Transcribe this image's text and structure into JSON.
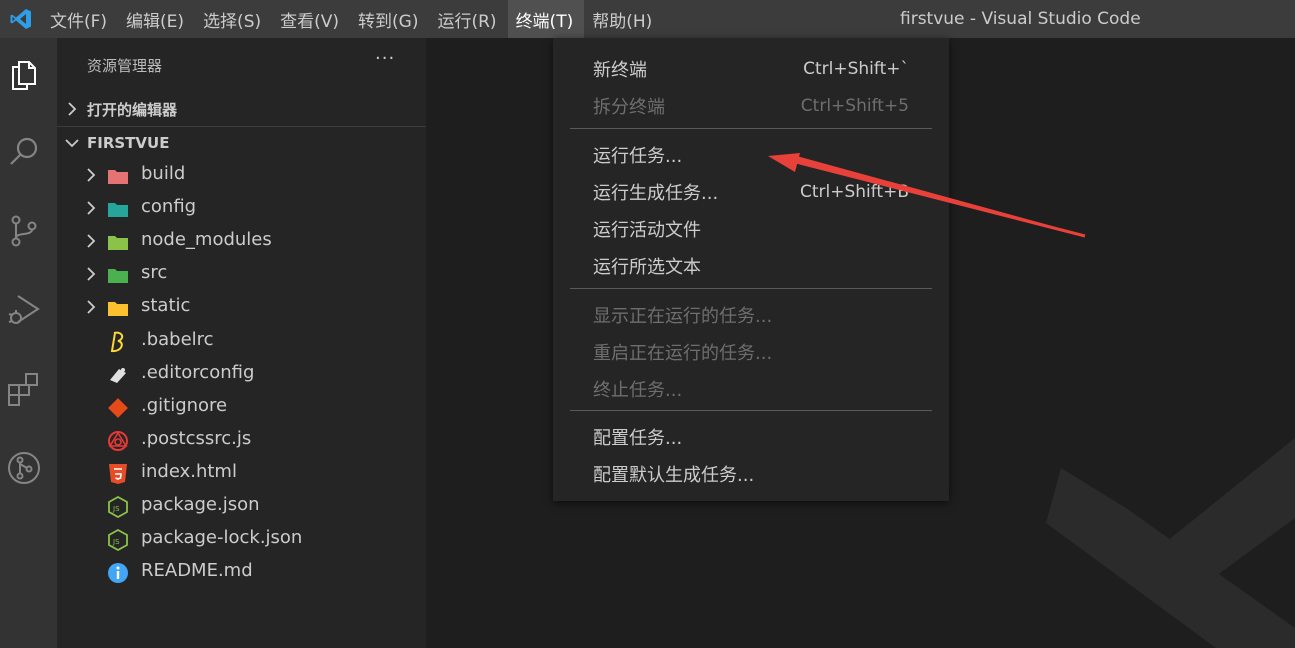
{
  "window": {
    "title": "firstvue - Visual Studio Code"
  },
  "menubar": {
    "items": [
      "文件(F)",
      "编辑(E)",
      "选择(S)",
      "查看(V)",
      "转到(G)",
      "运行(R)",
      "终端(T)",
      "帮助(H)"
    ],
    "active_index": 6
  },
  "activitybar": {
    "icons": [
      "files-icon",
      "search-icon",
      "source-control-icon",
      "run-debug-icon",
      "extensions-icon",
      "git-graph-icon"
    ],
    "active": "files-icon"
  },
  "sidebar": {
    "title": "资源管理器",
    "more": "···",
    "open_editors": {
      "label": "打开的编辑器",
      "expanded": false
    },
    "project": {
      "label": "FIRSTVUE",
      "expanded": true
    },
    "tree": [
      {
        "name": "build",
        "type": "folder",
        "icon": "folder-build-icon",
        "color": "#e57373"
      },
      {
        "name": "config",
        "type": "folder",
        "icon": "folder-config-icon",
        "color": "#26a69a"
      },
      {
        "name": "node_modules",
        "type": "folder",
        "icon": "folder-node-icon",
        "color": "#8bc34a"
      },
      {
        "name": "src",
        "type": "folder",
        "icon": "folder-src-icon",
        "color": "#4caf50"
      },
      {
        "name": "static",
        "type": "folder",
        "icon": "folder-static-icon",
        "color": "#fbc02d"
      },
      {
        "name": ".babelrc",
        "type": "file",
        "icon": "babel-icon",
        "color": "#fdd835"
      },
      {
        "name": ".editorconfig",
        "type": "file",
        "icon": "editorconfig-icon",
        "color": "#e0e0e0"
      },
      {
        "name": ".gitignore",
        "type": "file",
        "icon": "git-icon",
        "color": "#e64a19"
      },
      {
        "name": ".postcssrc.js",
        "type": "file",
        "icon": "postcss-icon",
        "color": "#e53935"
      },
      {
        "name": "index.html",
        "type": "file",
        "icon": "html5-icon",
        "color": "#e44d26"
      },
      {
        "name": "package.json",
        "type": "file",
        "icon": "nodejs-icon",
        "color": "#8bc34a"
      },
      {
        "name": "package-lock.json",
        "type": "file",
        "icon": "nodejs-icon",
        "color": "#8bc34a"
      },
      {
        "name": "README.md",
        "type": "file",
        "icon": "info-icon",
        "color": "#42a5f5"
      }
    ]
  },
  "terminal_menu": {
    "groups": [
      [
        {
          "label": "新终端",
          "shortcut": "Ctrl+Shift+`",
          "enabled": true
        },
        {
          "label": "拆分终端",
          "shortcut": "Ctrl+Shift+5",
          "enabled": false
        }
      ],
      [
        {
          "label": "运行任务...",
          "shortcut": "",
          "enabled": true
        },
        {
          "label": "运行生成任务...",
          "shortcut": "Ctrl+Shift+B",
          "enabled": true
        },
        {
          "label": "运行活动文件",
          "shortcut": "",
          "enabled": true
        },
        {
          "label": "运行所选文本",
          "shortcut": "",
          "enabled": true
        }
      ],
      [
        {
          "label": "显示正在运行的任务...",
          "shortcut": "",
          "enabled": false
        },
        {
          "label": "重启正在运行的任务...",
          "shortcut": "",
          "enabled": false
        },
        {
          "label": "终止任务...",
          "shortcut": "",
          "enabled": false
        }
      ],
      [
        {
          "label": "配置任务...",
          "shortcut": "",
          "enabled": true
        },
        {
          "label": "配置默认生成任务...",
          "shortcut": "",
          "enabled": true
        }
      ]
    ]
  },
  "annotation": {
    "color": "#e8413a",
    "points_to": "运行任务..."
  }
}
